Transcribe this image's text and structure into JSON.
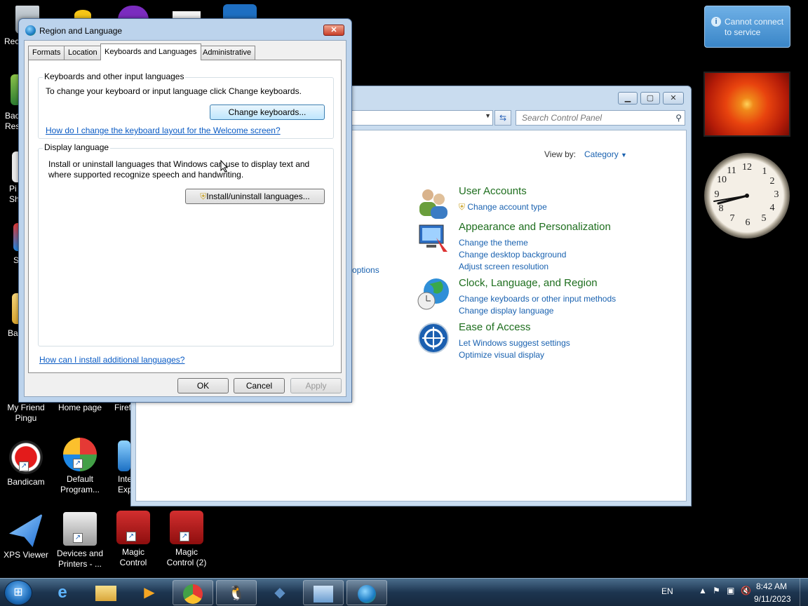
{
  "desktop": {
    "icons": [
      {
        "label": "Rec",
        "label2": ""
      },
      {
        "label": "Bac",
        "label2": "Res"
      },
      {
        "label": "Pi",
        "label2": "Sh"
      },
      {
        "label": "S",
        "label2": ""
      },
      {
        "label": "Ba",
        "label2": ""
      },
      {
        "label": "My Friend",
        "label2": "Pingu"
      },
      {
        "label": "Home page",
        "label2": ""
      },
      {
        "label": "Firef",
        "label2": ""
      },
      {
        "label": "Bandicam",
        "label2": ""
      },
      {
        "label": "Default",
        "label2": "Program..."
      },
      {
        "label": "Inte",
        "label2": "Exp"
      },
      {
        "label": "XPS Viewer",
        "label2": ""
      },
      {
        "label": "Devices and",
        "label2": "Printers - ..."
      },
      {
        "label": "Magic",
        "label2": "Control"
      },
      {
        "label": "Magic",
        "label2": "Control (2)"
      }
    ]
  },
  "gadgets": {
    "message_line1": "Cannot connect",
    "message_line2": "to service",
    "clock_numbers": [
      "12",
      "1",
      "2",
      "3",
      "4",
      "5",
      "6",
      "7",
      "8",
      "9",
      "10",
      "11"
    ]
  },
  "control_panel": {
    "search_placeholder": "Search Control Panel",
    "view_by_label": "View by:",
    "view_by_value": "Category",
    "partial_link": "options",
    "categories": [
      {
        "title": "User Accounts",
        "links": [
          "Change account type"
        ]
      },
      {
        "title": "Appearance and Personalization",
        "links": [
          "Change the theme",
          "Change desktop background",
          "Adjust screen resolution"
        ]
      },
      {
        "title": "Clock, Language, and Region",
        "links": [
          "Change keyboards or other input methods",
          "Change display language"
        ]
      },
      {
        "title": "Ease of Access",
        "links": [
          "Let Windows suggest settings",
          "Optimize visual display"
        ]
      }
    ]
  },
  "dialog": {
    "title": "Region and Language",
    "tabs": [
      "Formats",
      "Location",
      "Keyboards and Languages",
      "Administrative"
    ],
    "active_tab": "Keyboards and Languages",
    "keyboards_group": {
      "legend": "Keyboards and other input languages",
      "description": "To change your keyboard or input language click Change keyboards.",
      "button": "Change keyboards...",
      "help_link": "How do I change the keyboard layout for the Welcome screen?"
    },
    "display_group": {
      "legend": "Display language",
      "description_line1": "Install or uninstall languages that Windows can use to display text and",
      "description_line2": "where supported recognize speech and handwriting.",
      "button": "Install/uninstall languages..."
    },
    "bottom_link": "How can I install additional languages?",
    "ok": "OK",
    "cancel": "Cancel",
    "apply": "Apply"
  },
  "taskbar": {
    "language": "EN",
    "time": "8:42 AM",
    "date": "9/11/2023"
  }
}
